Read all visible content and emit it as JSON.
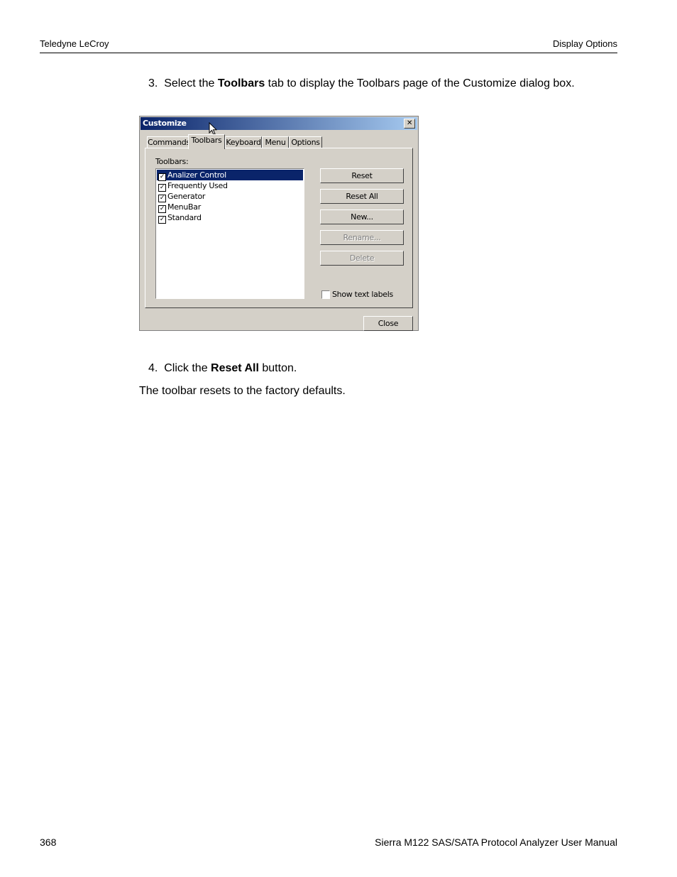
{
  "header": {
    "left": "Teledyne LeCroy",
    "right": "Display Options"
  },
  "steps": [
    {
      "number": "3.",
      "prefix": "Select the",
      "bold": "Toolbars",
      "suffix": "tab to display the Toolbars page of the Customize dialog box."
    },
    {
      "number": "4.",
      "prefix": "Click the",
      "bold": "Reset All",
      "suffix": "button."
    }
  ],
  "result_text": "The toolbar resets to the factory defaults.",
  "dialog": {
    "title": "Customize",
    "close_glyph": "✕",
    "tabs": [
      "Commands",
      "Toolbars",
      "Keyboard",
      "Menu",
      "Options"
    ],
    "active_tab": "Toolbars",
    "list_label": "Toolbars:",
    "toolbars": [
      {
        "label": "Analizer Control",
        "checked": true,
        "selected": true
      },
      {
        "label": "Frequently Used",
        "checked": true,
        "selected": false
      },
      {
        "label": "Generator",
        "checked": true,
        "selected": false
      },
      {
        "label": "MenuBar",
        "checked": true,
        "selected": false
      },
      {
        "label": "Standard",
        "checked": true,
        "selected": false
      }
    ],
    "buttons": {
      "reset": "Reset",
      "reset_all": "Reset All",
      "new": "New...",
      "rename": "Rename...",
      "delete": "Delete",
      "close": "Close"
    },
    "show_text_labels": {
      "label": "Show text labels",
      "checked": false
    }
  },
  "footer": {
    "page_number": "368",
    "title": "Sierra M122 SAS/SATA Protocol Analyzer User Manual"
  }
}
